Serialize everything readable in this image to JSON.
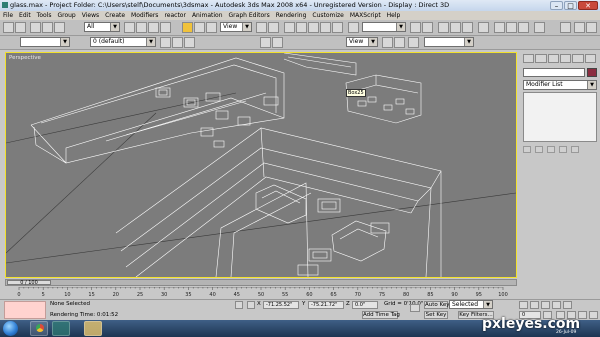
{
  "window": {
    "title": "glass.max     -    Project Folder: C:\\Users\\stelf\\Documents\\3dsmax     -    Autodesk 3ds Max 2008 x64     -    Unregistered Version     -    Display : Direct 3D",
    "minimize": "–",
    "maximize": "□",
    "close": "✕"
  },
  "menu": [
    "File",
    "Edit",
    "Tools",
    "Group",
    "Views",
    "Create",
    "Modifiers",
    "reactor",
    "Animation",
    "Graph Editors",
    "Rendering",
    "Customize",
    "MAXScript",
    "Help"
  ],
  "toolbar": {
    "selection_filter": "All",
    "reference_coord": "View",
    "named_selection": ""
  },
  "toolbar2": {
    "layer_value": "0 (default)",
    "snap_view": "View"
  },
  "viewport": {
    "label": "Perspective",
    "tooltip": "Box25"
  },
  "command_panel": {
    "modifier_list": "Modifier List"
  },
  "timeline": {
    "frame_counter": "0 / 100",
    "ticks": [
      "0",
      "5",
      "10",
      "15",
      "20",
      "25",
      "30",
      "35",
      "40",
      "45",
      "50",
      "55",
      "60",
      "65",
      "70",
      "75",
      "80",
      "85",
      "90",
      "95",
      "100"
    ]
  },
  "status": {
    "selection_text": "None Selected",
    "render_time": "Rendering Time: 0:01:52",
    "x_value": "-71.25.52\"",
    "y_value": "-75.21.72\"",
    "z_value": "0.0\"",
    "grid": "Grid = 0'10.0\"",
    "add_time_tag": "Add Time Tag",
    "auto_key": "Auto Key",
    "set_key": "Set Key",
    "key_mode_value": "Selected",
    "key_filters": "Key Filters...",
    "frame_field": "0"
  },
  "taskbar": {
    "clock": "26-Jul-09"
  },
  "watermark": "pxleyes.com",
  "colors": {
    "viewport_bg": "#7c7c7c",
    "active_border": "#f2e12c",
    "object_color": "#8b2d40",
    "wire": "#ffffff"
  }
}
